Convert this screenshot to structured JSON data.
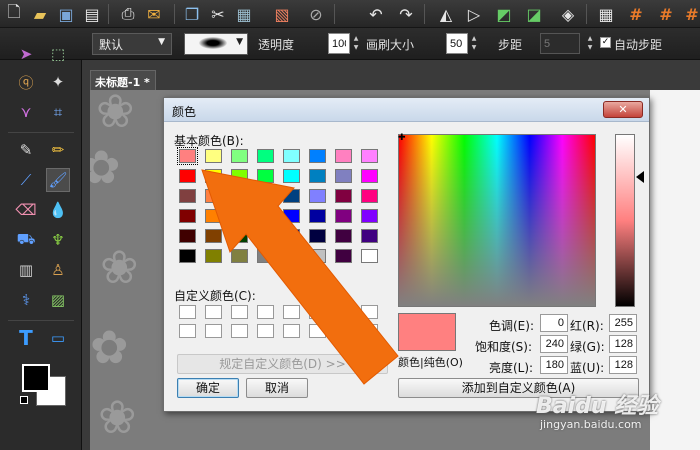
{
  "top_toolbar": {
    "icons": [
      "new-file-icon",
      "open-folder-icon",
      "save-icon",
      "save-as-icon",
      "print-icon",
      "email-icon",
      "copy-icon",
      "cut-icon",
      "layer-icon",
      "paste-icon",
      "clear-icon",
      "undo-icon",
      "redo-icon",
      "flip-icon",
      "rotate-icon",
      "warp-icon",
      "perspective-icon",
      "brush-shape-icon",
      "grid-icon",
      "hash-icon",
      "hash-icon",
      "hash-icon"
    ]
  },
  "option_bar": {
    "preset_value": "默认",
    "opacity_label": "透明度",
    "opacity_value": "100",
    "brush_size_label": "画刷大小",
    "brush_size_value": "50",
    "step_label": "步距",
    "step_value": "5",
    "auto_step_label": "自动步距"
  },
  "document": {
    "tab_title": "未标题-1 *"
  },
  "color_dialog": {
    "title": "颜色",
    "close_label": "✕",
    "basic_colors_label": "基本颜色(B):",
    "custom_colors_label": "自定义颜色(C):",
    "define_custom_button": "规定自定义颜色(D) >>",
    "ok_button": "确定",
    "cancel_button": "取消",
    "color_solid_label": "颜色|纯色(O)",
    "add_custom_button": "添加到自定义颜色(A)",
    "hue_label": "色调(E):",
    "hue_value": "0",
    "sat_label": "饱和度(S):",
    "sat_value": "240",
    "lum_label": "亮度(L):",
    "lum_value": "180",
    "red_label": "红(R):",
    "red_value": "255",
    "green_label": "绿(G):",
    "green_value": "128",
    "blue_label": "蓝(U):",
    "blue_value": "128",
    "preview_color": "#ff8080",
    "basic_colors": [
      [
        "#ff8080",
        "#ffff80",
        "#80ff80",
        "#00ff80",
        "#80ffff",
        "#0080ff",
        "#ff80c0",
        "#ff80ff"
      ],
      [
        "#ff0000",
        "#ffff00",
        "#80ff00",
        "#00ff40",
        "#00ffff",
        "#0080c0",
        "#8080c0",
        "#ff00ff"
      ],
      [
        "#804040",
        "#ff8040",
        "#00ff00",
        "#008080",
        "#004080",
        "#8080ff",
        "#800040",
        "#ff0080"
      ],
      [
        "#800000",
        "#ff8000",
        "#008000",
        "#008040",
        "#0000ff",
        "#0000a0",
        "#800080",
        "#8000ff"
      ],
      [
        "#400000",
        "#804000",
        "#004000",
        "#004040",
        "#000080",
        "#000040",
        "#400040",
        "#400080"
      ],
      [
        "#000000",
        "#808000",
        "#808040",
        "#808080",
        "#408080",
        "#c0c0c0",
        "#400040",
        "#ffffff"
      ]
    ]
  },
  "watermark": {
    "logo_text": "Baidu 经验",
    "url": "jingyan.baidu.com"
  },
  "colors": {
    "accent_arrow": "#f26e0e",
    "selected_swatch": "#ff8080"
  }
}
